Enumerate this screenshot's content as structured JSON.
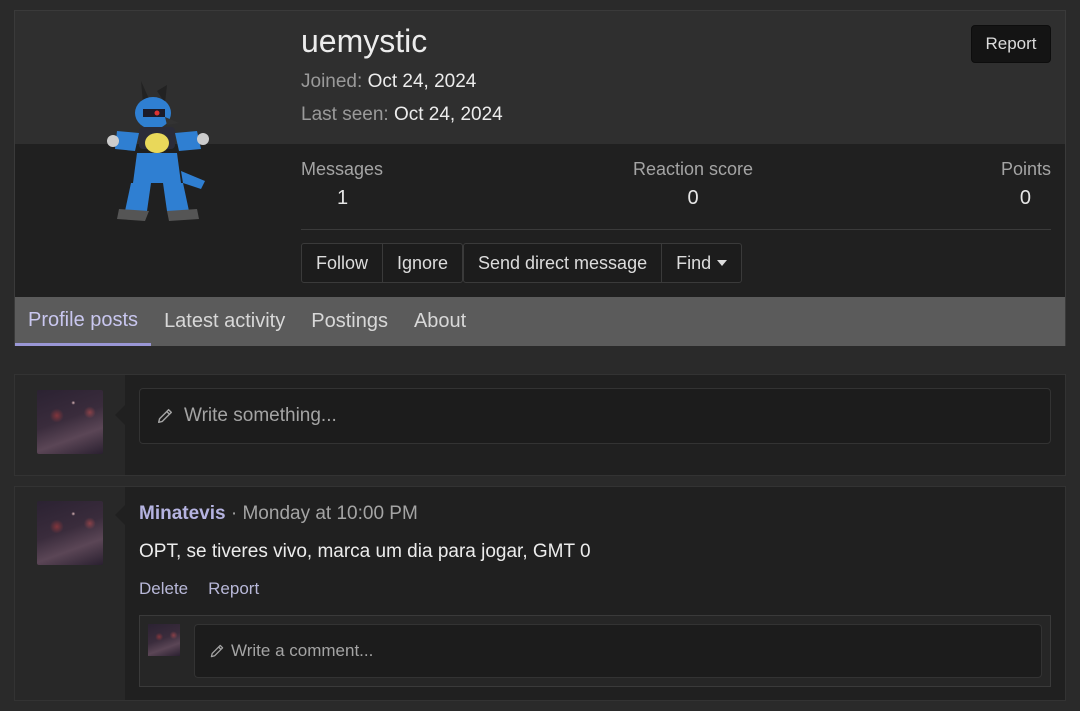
{
  "profile": {
    "username": "uemystic",
    "joined_label": "Joined:",
    "joined_value": "Oct 24, 2024",
    "last_seen_label": "Last seen:",
    "last_seen_value": "Oct 24, 2024",
    "report_label": "Report",
    "stats": [
      {
        "label": "Messages",
        "value": "1"
      },
      {
        "label": "Reaction score",
        "value": "0"
      },
      {
        "label": "Points",
        "value": "0"
      }
    ],
    "actions": {
      "follow": "Follow",
      "ignore": "Ignore",
      "send_dm": "Send direct message",
      "find": "Find"
    },
    "tabs": [
      "Profile posts",
      "Latest activity",
      "Postings",
      "About"
    ],
    "active_tab": "Profile posts"
  },
  "composer": {
    "placeholder": "Write something..."
  },
  "post": {
    "author": "Minatevis",
    "separator": " · ",
    "time": "Monday at 10:00 PM",
    "body": "OPT, se tiveres vivo, marca um dia para jogar, GMT 0",
    "delete_label": "Delete",
    "report_label": "Report",
    "comment_placeholder": "Write a comment..."
  },
  "icons": {
    "avatar": "lucario-pixel-avatar",
    "pencil": "pencil-icon",
    "caret": "caret-down-icon"
  },
  "colors": {
    "background": "#2a2a2a",
    "accent": "#9a97d6",
    "author": "#b5b3e0"
  }
}
